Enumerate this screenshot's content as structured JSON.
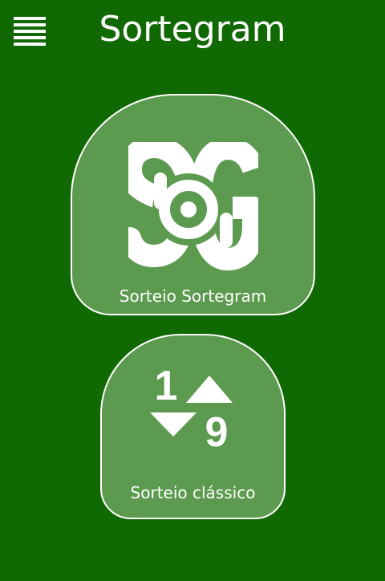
{
  "header": {
    "title": "Sortegram",
    "menu_icon": "hamburger-menu-icon"
  },
  "tiles": [
    {
      "label": "Sorteio Sortegram",
      "icon": "sortegram-logo-icon",
      "logo_text": "SG"
    },
    {
      "label": "Sorteio clássico",
      "icon": "sort-numbers-icon",
      "icon_digits": [
        "1",
        "9"
      ]
    }
  ],
  "colors": {
    "background": "#106902",
    "tile_fill": "#5c9b4f",
    "foreground": "#ffffff"
  }
}
